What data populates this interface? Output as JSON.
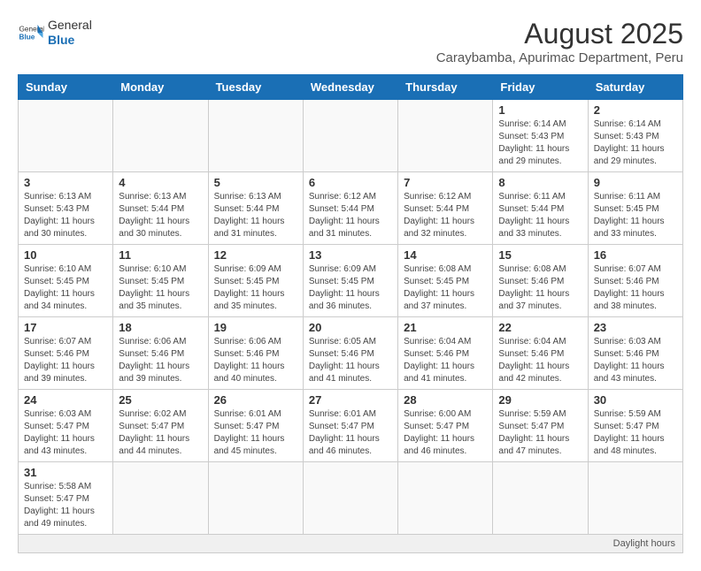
{
  "app": {
    "logo_general": "General",
    "logo_blue": "Blue"
  },
  "title": "August 2025",
  "subtitle": "Caraybamba, Apurimac Department, Peru",
  "weekdays": [
    "Sunday",
    "Monday",
    "Tuesday",
    "Wednesday",
    "Thursday",
    "Friday",
    "Saturday"
  ],
  "footer": "Daylight hours",
  "weeks": [
    [
      {
        "day": "",
        "info": ""
      },
      {
        "day": "",
        "info": ""
      },
      {
        "day": "",
        "info": ""
      },
      {
        "day": "",
        "info": ""
      },
      {
        "day": "",
        "info": ""
      },
      {
        "day": "1",
        "info": "Sunrise: 6:14 AM\nSunset: 5:43 PM\nDaylight: 11 hours\nand 29 minutes."
      },
      {
        "day": "2",
        "info": "Sunrise: 6:14 AM\nSunset: 5:43 PM\nDaylight: 11 hours\nand 29 minutes."
      }
    ],
    [
      {
        "day": "3",
        "info": "Sunrise: 6:13 AM\nSunset: 5:43 PM\nDaylight: 11 hours\nand 30 minutes."
      },
      {
        "day": "4",
        "info": "Sunrise: 6:13 AM\nSunset: 5:44 PM\nDaylight: 11 hours\nand 30 minutes."
      },
      {
        "day": "5",
        "info": "Sunrise: 6:13 AM\nSunset: 5:44 PM\nDaylight: 11 hours\nand 31 minutes."
      },
      {
        "day": "6",
        "info": "Sunrise: 6:12 AM\nSunset: 5:44 PM\nDaylight: 11 hours\nand 31 minutes."
      },
      {
        "day": "7",
        "info": "Sunrise: 6:12 AM\nSunset: 5:44 PM\nDaylight: 11 hours\nand 32 minutes."
      },
      {
        "day": "8",
        "info": "Sunrise: 6:11 AM\nSunset: 5:44 PM\nDaylight: 11 hours\nand 33 minutes."
      },
      {
        "day": "9",
        "info": "Sunrise: 6:11 AM\nSunset: 5:45 PM\nDaylight: 11 hours\nand 33 minutes."
      }
    ],
    [
      {
        "day": "10",
        "info": "Sunrise: 6:10 AM\nSunset: 5:45 PM\nDaylight: 11 hours\nand 34 minutes."
      },
      {
        "day": "11",
        "info": "Sunrise: 6:10 AM\nSunset: 5:45 PM\nDaylight: 11 hours\nand 35 minutes."
      },
      {
        "day": "12",
        "info": "Sunrise: 6:09 AM\nSunset: 5:45 PM\nDaylight: 11 hours\nand 35 minutes."
      },
      {
        "day": "13",
        "info": "Sunrise: 6:09 AM\nSunset: 5:45 PM\nDaylight: 11 hours\nand 36 minutes."
      },
      {
        "day": "14",
        "info": "Sunrise: 6:08 AM\nSunset: 5:45 PM\nDaylight: 11 hours\nand 37 minutes."
      },
      {
        "day": "15",
        "info": "Sunrise: 6:08 AM\nSunset: 5:46 PM\nDaylight: 11 hours\nand 37 minutes."
      },
      {
        "day": "16",
        "info": "Sunrise: 6:07 AM\nSunset: 5:46 PM\nDaylight: 11 hours\nand 38 minutes."
      }
    ],
    [
      {
        "day": "17",
        "info": "Sunrise: 6:07 AM\nSunset: 5:46 PM\nDaylight: 11 hours\nand 39 minutes."
      },
      {
        "day": "18",
        "info": "Sunrise: 6:06 AM\nSunset: 5:46 PM\nDaylight: 11 hours\nand 39 minutes."
      },
      {
        "day": "19",
        "info": "Sunrise: 6:06 AM\nSunset: 5:46 PM\nDaylight: 11 hours\nand 40 minutes."
      },
      {
        "day": "20",
        "info": "Sunrise: 6:05 AM\nSunset: 5:46 PM\nDaylight: 11 hours\nand 41 minutes."
      },
      {
        "day": "21",
        "info": "Sunrise: 6:04 AM\nSunset: 5:46 PM\nDaylight: 11 hours\nand 41 minutes."
      },
      {
        "day": "22",
        "info": "Sunrise: 6:04 AM\nSunset: 5:46 PM\nDaylight: 11 hours\nand 42 minutes."
      },
      {
        "day": "23",
        "info": "Sunrise: 6:03 AM\nSunset: 5:46 PM\nDaylight: 11 hours\nand 43 minutes."
      }
    ],
    [
      {
        "day": "24",
        "info": "Sunrise: 6:03 AM\nSunset: 5:47 PM\nDaylight: 11 hours\nand 43 minutes."
      },
      {
        "day": "25",
        "info": "Sunrise: 6:02 AM\nSunset: 5:47 PM\nDaylight: 11 hours\nand 44 minutes."
      },
      {
        "day": "26",
        "info": "Sunrise: 6:01 AM\nSunset: 5:47 PM\nDaylight: 11 hours\nand 45 minutes."
      },
      {
        "day": "27",
        "info": "Sunrise: 6:01 AM\nSunset: 5:47 PM\nDaylight: 11 hours\nand 46 minutes."
      },
      {
        "day": "28",
        "info": "Sunrise: 6:00 AM\nSunset: 5:47 PM\nDaylight: 11 hours\nand 46 minutes."
      },
      {
        "day": "29",
        "info": "Sunrise: 5:59 AM\nSunset: 5:47 PM\nDaylight: 11 hours\nand 47 minutes."
      },
      {
        "day": "30",
        "info": "Sunrise: 5:59 AM\nSunset: 5:47 PM\nDaylight: 11 hours\nand 48 minutes."
      }
    ],
    [
      {
        "day": "31",
        "info": "Sunrise: 5:58 AM\nSunset: 5:47 PM\nDaylight: 11 hours\nand 49 minutes."
      },
      {
        "day": "",
        "info": ""
      },
      {
        "day": "",
        "info": ""
      },
      {
        "day": "",
        "info": ""
      },
      {
        "day": "",
        "info": ""
      },
      {
        "day": "",
        "info": ""
      },
      {
        "day": "",
        "info": ""
      }
    ]
  ]
}
